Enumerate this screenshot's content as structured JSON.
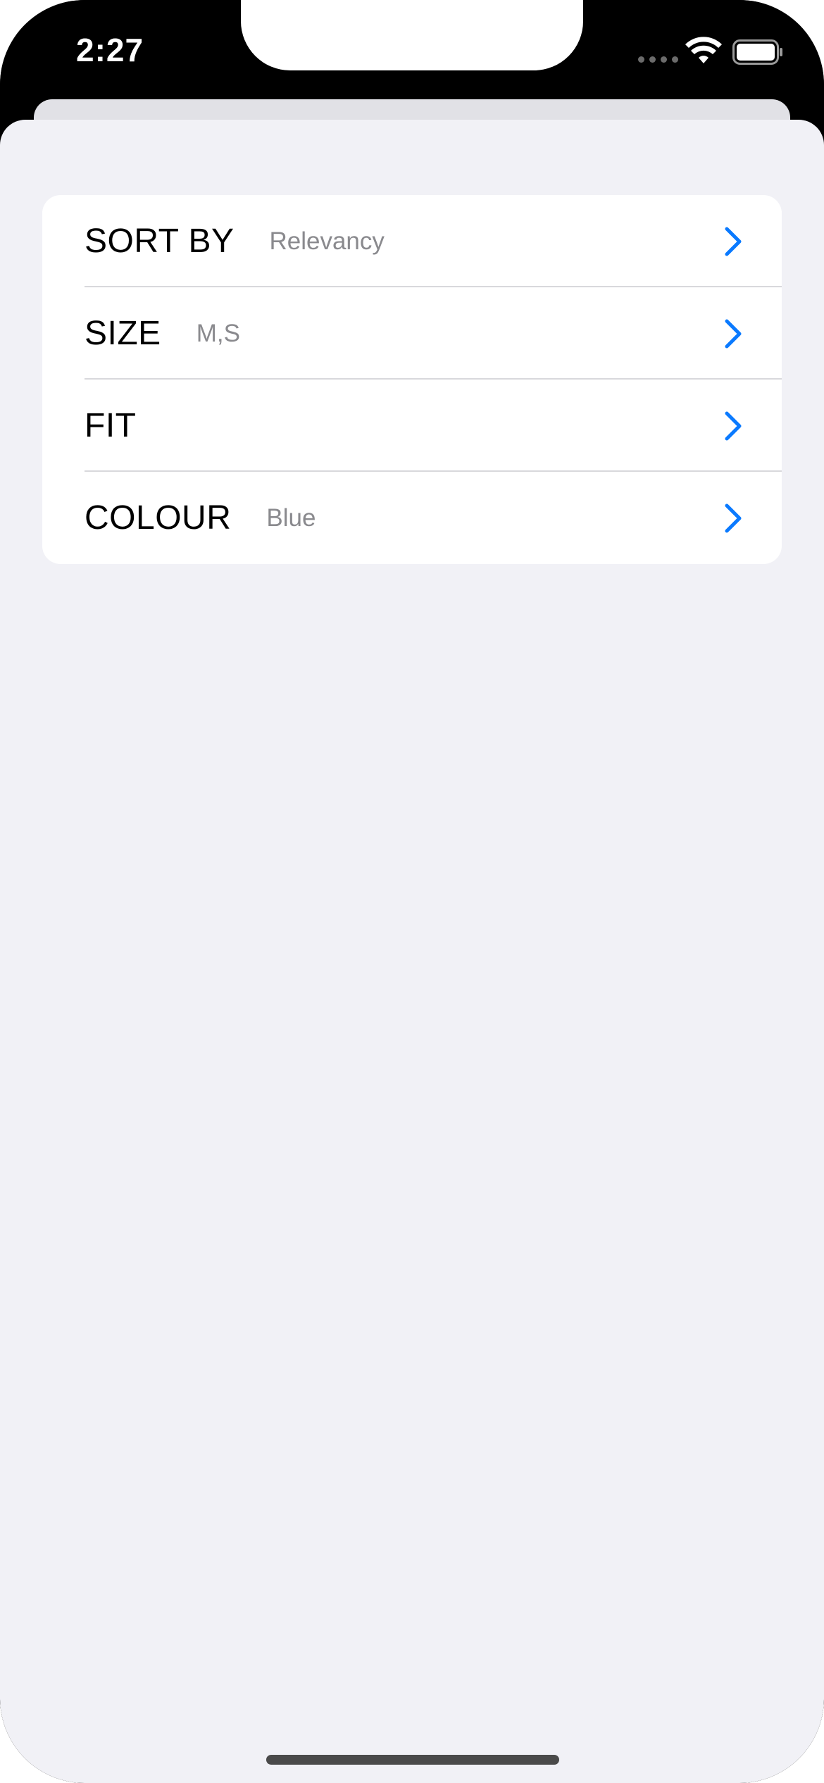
{
  "status_bar": {
    "time": "2:27"
  },
  "filters": {
    "rows": [
      {
        "label": "SORT BY",
        "value": "Relevancy"
      },
      {
        "label": "SIZE",
        "value": "M,S"
      },
      {
        "label": "FIT",
        "value": ""
      },
      {
        "label": "COLOUR",
        "value": "Blue"
      }
    ]
  },
  "colors": {
    "accent": "#0a7aff",
    "background": "#f1f1f6",
    "card": "#ffffff",
    "secondary_text": "#8a8a8e"
  },
  "icons": {
    "wifi": "wifi-icon",
    "battery": "battery-icon",
    "chevron": "chevron-right-icon"
  }
}
